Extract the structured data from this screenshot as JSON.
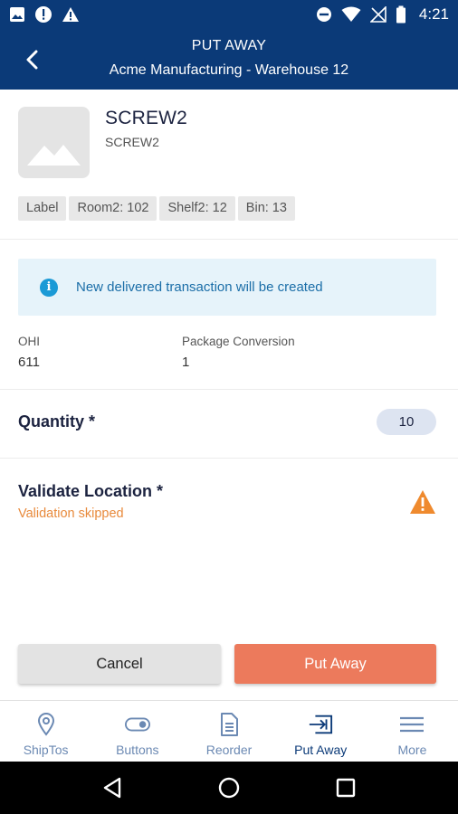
{
  "status_bar": {
    "time": "4:21",
    "left_icons": [
      "image-icon",
      "alert-circle-icon",
      "warning-icon"
    ],
    "right_icons": [
      "do-not-disturb-icon",
      "wifi-icon",
      "no-signal-icon",
      "battery-icon"
    ]
  },
  "header": {
    "title": "PUT AWAY",
    "subtitle": "Acme Manufacturing - Warehouse 12",
    "back_icon": "chevron-left-icon"
  },
  "product": {
    "name": "SCREW2",
    "code": "SCREW2",
    "image_icon": "image-placeholder-icon",
    "tags": [
      "Label",
      "Room2: 102",
      "Shelf2: 12",
      "Bin: 13"
    ]
  },
  "banner": {
    "icon": "info-icon",
    "text": "New delivered transaction will be created"
  },
  "stats": {
    "ohi_label": "OHI",
    "ohi_value": "611",
    "conversion_label": "Package Conversion",
    "conversion_value": "1"
  },
  "quantity": {
    "label": "Quantity *",
    "value": "10"
  },
  "validate": {
    "label": "Validate Location *",
    "note": "Validation skipped",
    "icon": "warning-triangle-icon"
  },
  "actions": {
    "cancel_label": "Cancel",
    "put_away_label": "Put Away"
  },
  "bottom_nav": {
    "items": [
      {
        "label": "ShipTos",
        "icon": "location-pin-icon"
      },
      {
        "label": "Buttons",
        "icon": "toggle-icon"
      },
      {
        "label": "Reorder",
        "icon": "document-icon"
      },
      {
        "label": "Put Away",
        "icon": "put-away-icon"
      },
      {
        "label": "More",
        "icon": "menu-icon"
      }
    ],
    "active": "Put Away"
  },
  "colors": {
    "primary": "#0b3a78",
    "accent": "#ec7a5c",
    "warning": "#e88a3c",
    "info": "#1b9ad6"
  }
}
